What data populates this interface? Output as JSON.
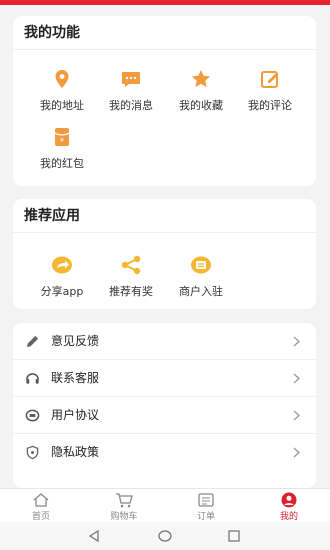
{
  "my_functions": {
    "title": "我的功能",
    "items": [
      {
        "label": "我的地址",
        "icon": "location-icon"
      },
      {
        "label": "我的消息",
        "icon": "message-icon"
      },
      {
        "label": "我的收藏",
        "icon": "star-icon"
      },
      {
        "label": "我的评论",
        "icon": "edit-icon"
      },
      {
        "label": "我的红包",
        "icon": "red-envelope-icon"
      }
    ]
  },
  "recommended_apps": {
    "title": "推荐应用",
    "items": [
      {
        "label": "分享app",
        "icon": "share-icon"
      },
      {
        "label": "推荐有奖",
        "icon": "recommend-icon"
      },
      {
        "label": "商户入驻",
        "icon": "merchant-icon"
      }
    ]
  },
  "settings_list": {
    "items": [
      {
        "label": "意见反馈",
        "icon": "pencil-icon"
      },
      {
        "label": "联系客服",
        "icon": "headset-icon"
      },
      {
        "label": "用户协议",
        "icon": "agreement-icon"
      },
      {
        "label": "隐私政策",
        "icon": "shield-icon"
      }
    ]
  },
  "tab_bar": {
    "tabs": [
      {
        "label": "首页",
        "icon": "home-icon"
      },
      {
        "label": "购物车",
        "icon": "cart-icon"
      },
      {
        "label": "订单",
        "icon": "order-icon"
      },
      {
        "label": "我的",
        "icon": "profile-icon",
        "active": true
      }
    ]
  },
  "colors": {
    "accent_red": "#e8232f",
    "icon_orange": "#f19a3e",
    "icon_yellow": "#f5b731",
    "background": "#f3f3f3"
  }
}
